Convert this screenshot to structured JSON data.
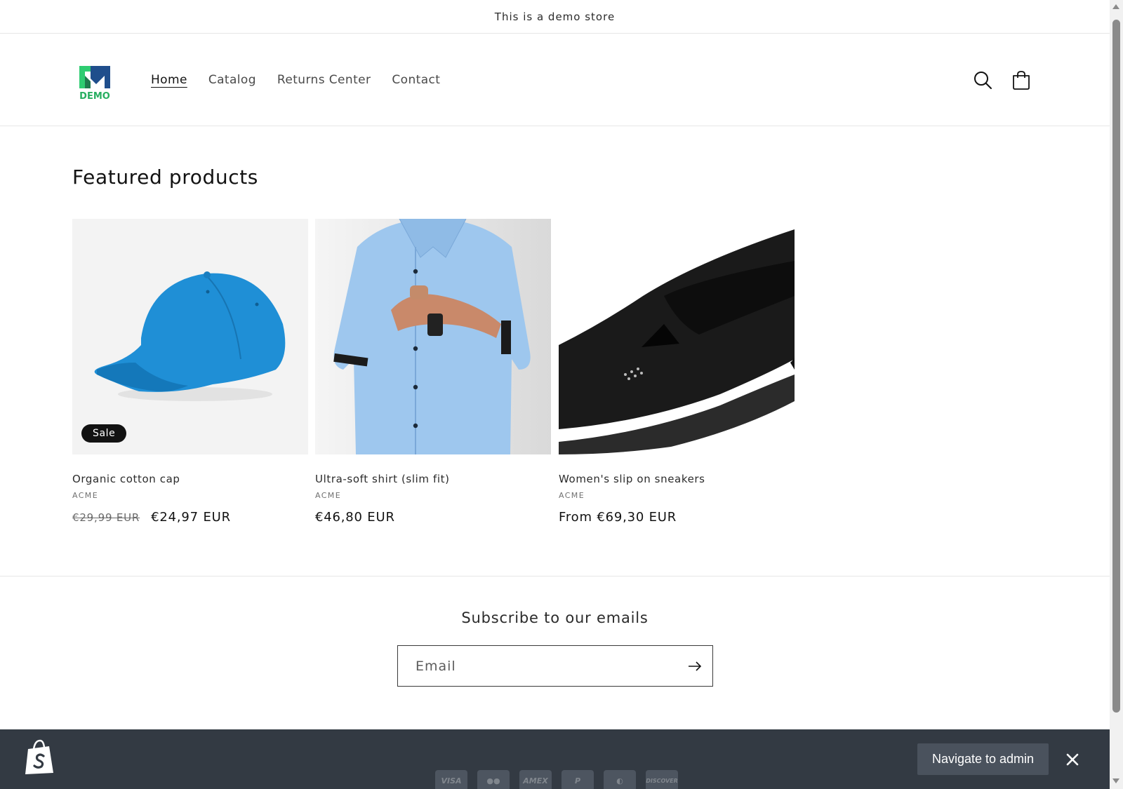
{
  "announcement": "This is a demo store",
  "header": {
    "logo_text": "DEMO",
    "nav": [
      {
        "label": "Home",
        "active": true
      },
      {
        "label": "Catalog",
        "active": false
      },
      {
        "label": "Returns Center",
        "active": false
      },
      {
        "label": "Contact",
        "active": false
      }
    ],
    "icons": [
      "search-icon",
      "cart-icon"
    ]
  },
  "featured": {
    "heading": "Featured products",
    "products": [
      {
        "title": "Organic cotton cap",
        "vendor": "ACME",
        "price_old": "€29,99 EUR",
        "price": "€24,97 EUR",
        "badge": "Sale",
        "image": "blue-cap"
      },
      {
        "title": "Ultra-soft shirt (slim fit)",
        "vendor": "ACME",
        "price": "€46,80 EUR",
        "image": "light-blue-shirt"
      },
      {
        "title": "Women's slip on sneakers",
        "vendor": "ACME",
        "price": "From €69,30 EUR",
        "image": "black-sneaker"
      }
    ]
  },
  "newsletter": {
    "heading": "Subscribe to our emails",
    "email_placeholder": "Email"
  },
  "footer": {
    "payment_icons": [
      "VISA",
      "mastercard",
      "AMEX",
      "paypal",
      "diners",
      "DISCOVER"
    ],
    "admin_button": "Navigate to admin",
    "colors": {
      "bar": "#333a43",
      "button": "#4a525d"
    }
  }
}
